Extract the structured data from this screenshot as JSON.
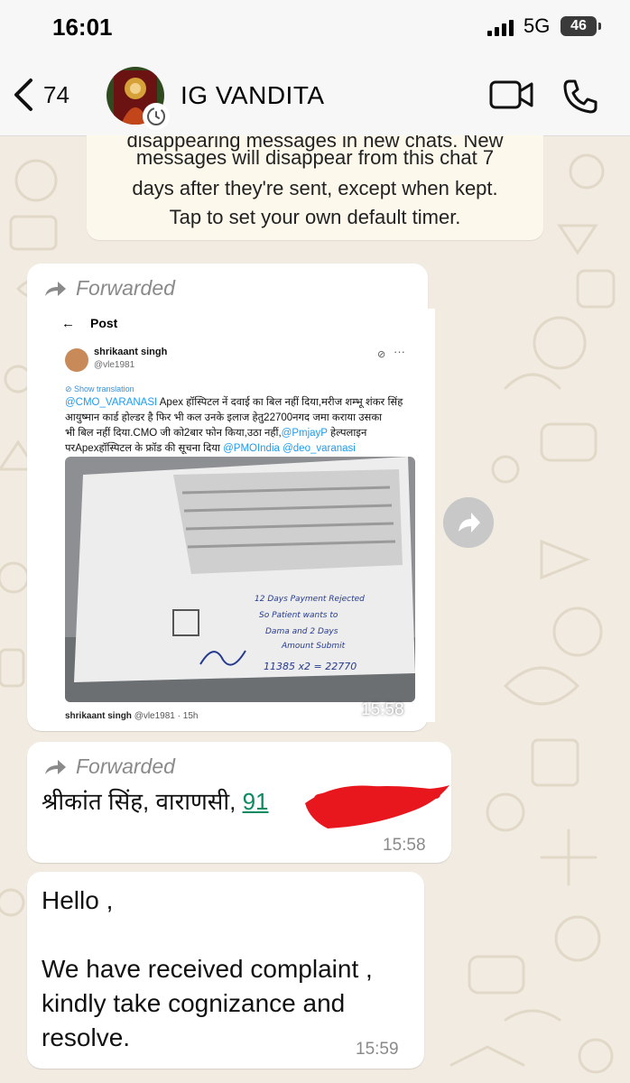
{
  "status_bar": {
    "time": "16:01",
    "network": "5G",
    "battery": "46"
  },
  "header": {
    "back_count": "74",
    "contact_name": "IG VANDITA"
  },
  "system_notice": {
    "cut_line": "disappearing messages in new chats. New",
    "line1": "messages will disappear from this chat 7",
    "line2": "days after they're sent, except when kept.",
    "line3": "Tap to set your own default timer."
  },
  "messages": [
    {
      "forwarded_label": "Forwarded",
      "time": "15:58",
      "post": {
        "back_arrow": "←",
        "title": "Post",
        "author_name": "shrikaant singh",
        "author_handle": "@vle1981",
        "more": "···",
        "show_translation": "Show translation",
        "text_lines": [
          [
            "@CMO_VARANASI",
            " Apex हॉस्पिटल नें दवाई का बिल नहीं दिया,मरीज शम्भू शंकर सिंह"
          ],
          [
            "",
            "आयुष्मान कार्ड होल्डर है फिर भी कल उनके इलाज हेतु22700नगद जमा कराया उसका"
          ],
          [
            "",
            "भी बिल नहीं दिया.CMO जी को2बार फोन किया,उठा नहीं,",
            "@PmjayP",
            " हेल्पलाइन"
          ],
          [
            "",
            "परApexहॉस्पिटल के फ्रॉड की सूचना दिया ",
            "@PMOIndia",
            " ",
            "@deo_varanasi"
          ]
        ],
        "footer_name": "shrikaant singh",
        "footer_handle": "@vle1981 · 15h",
        "handwriting": [
          "12 Days Payment Rejected",
          "So Patient wants to",
          "Dama and 2 Days",
          "Amount Submit",
          "11385 x2 = 22770"
        ]
      }
    },
    {
      "forwarded_label": "Forwarded",
      "text_prefix": "श्रीकांत सिंह, वाराणसी, ",
      "phone_visible": "91",
      "time": "15:58"
    },
    {
      "lines": [
        "Hello ,",
        "",
        "We have received complaint ,",
        "kindly take cognizance and",
        "resolve."
      ],
      "time": "15:59"
    }
  ],
  "icons": {
    "back": "chevron-left-icon",
    "video": "video-camera-icon",
    "call": "phone-icon",
    "forward": "forward-arrow-icon",
    "share": "share-forward-icon",
    "signal": "cellular-signal-icon",
    "timer": "disappearing-timer-icon"
  },
  "colors": {
    "chat_background": "#f1ebe2",
    "bubble": "#ffffff",
    "link_green": "#0a8a62",
    "twitter_blue": "#1d9bf0"
  }
}
